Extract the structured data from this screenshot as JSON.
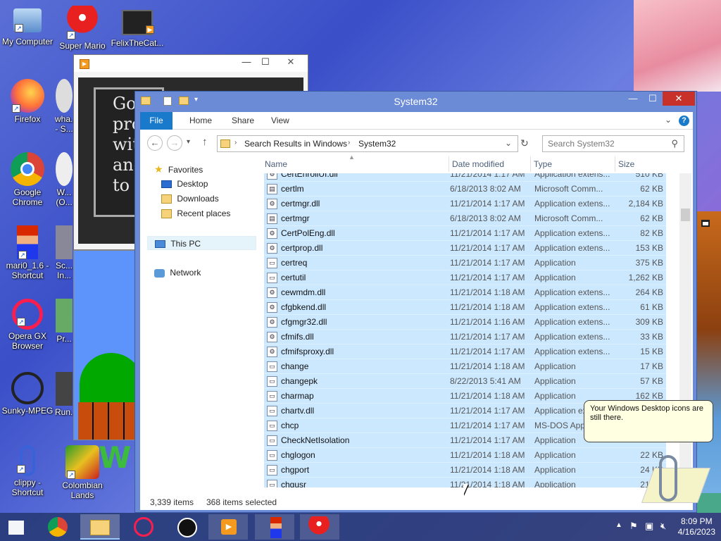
{
  "desktop": {
    "icons": [
      {
        "label": "My Computer"
      },
      {
        "label": "Super Mario"
      },
      {
        "label": "FelixTheCat..."
      },
      {
        "label": "Firefox"
      },
      {
        "label": "wha...\n- S..."
      },
      {
        "label": "Google Chrome"
      },
      {
        "label": "W...\n(O..."
      },
      {
        "label": "mari0_1.6 - Shortcut"
      },
      {
        "label": "Sc...\nIn..."
      },
      {
        "label": "Opera GX Browser"
      },
      {
        "label": "Pr..."
      },
      {
        "label": "Sunky-MPEG"
      },
      {
        "label": "Run..."
      },
      {
        "label": "clippy - Shortcut"
      },
      {
        "label": "Colombian Lands"
      }
    ]
  },
  "media_window": {
    "slide_text": [
      "Go",
      "pro",
      "wit",
      "and",
      "to"
    ],
    "minimize": "—",
    "maximize": "☐",
    "close": "✕"
  },
  "explorer": {
    "title": "System32",
    "minimize": "—",
    "maximize": "☐",
    "close": "✕",
    "ribbon_tabs": [
      "File",
      "Home",
      "Share",
      "View"
    ],
    "address": {
      "crumbs": [
        "Search Results in Windows",
        "System32"
      ]
    },
    "search_placeholder": "Search System32",
    "nav": {
      "favorites": "Favorites",
      "desktop": "Desktop",
      "downloads": "Downloads",
      "recent": "Recent places",
      "thispc": "This PC",
      "network": "Network"
    },
    "columns": {
      "name": "Name",
      "date": "Date modified",
      "type": "Type",
      "size": "Size"
    },
    "files": [
      {
        "name": "CertEnrollUI.dll",
        "date": "11/21/2014 1:17 AM",
        "type": "Application extens...",
        "size": "510 KB"
      },
      {
        "name": "certlm",
        "date": "6/18/2013 8:02 AM",
        "type": "Microsoft Comm...",
        "size": "62 KB"
      },
      {
        "name": "certmgr.dll",
        "date": "11/21/2014 1:17 AM",
        "type": "Application extens...",
        "size": "2,184 KB"
      },
      {
        "name": "certmgr",
        "date": "6/18/2013 8:02 AM",
        "type": "Microsoft Comm...",
        "size": "62 KB"
      },
      {
        "name": "CertPolEng.dll",
        "date": "11/21/2014 1:17 AM",
        "type": "Application extens...",
        "size": "82 KB"
      },
      {
        "name": "certprop.dll",
        "date": "11/21/2014 1:17 AM",
        "type": "Application extens...",
        "size": "153 KB"
      },
      {
        "name": "certreq",
        "date": "11/21/2014 1:17 AM",
        "type": "Application",
        "size": "375 KB"
      },
      {
        "name": "certutil",
        "date": "11/21/2014 1:17 AM",
        "type": "Application",
        "size": "1,262 KB"
      },
      {
        "name": "cewmdm.dll",
        "date": "11/21/2014 1:18 AM",
        "type": "Application extens...",
        "size": "264 KB"
      },
      {
        "name": "cfgbkend.dll",
        "date": "11/21/2014 1:18 AM",
        "type": "Application extens...",
        "size": "61 KB"
      },
      {
        "name": "cfgmgr32.dll",
        "date": "11/21/2014 1:16 AM",
        "type": "Application extens...",
        "size": "309 KB"
      },
      {
        "name": "cfmifs.dll",
        "date": "11/21/2014 1:17 AM",
        "type": "Application extens...",
        "size": "33 KB"
      },
      {
        "name": "cfmifsproxy.dll",
        "date": "11/21/2014 1:17 AM",
        "type": "Application extens...",
        "size": "15 KB"
      },
      {
        "name": "change",
        "date": "11/21/2014 1:18 AM",
        "type": "Application",
        "size": "17 KB"
      },
      {
        "name": "changepk",
        "date": "8/22/2013 5:41 AM",
        "type": "Application",
        "size": "57 KB"
      },
      {
        "name": "charmap",
        "date": "11/21/2014 1:18 AM",
        "type": "Application",
        "size": "162 KB"
      },
      {
        "name": "chartv.dll",
        "date": "11/21/2014 1:17 AM",
        "type": "Application exten...",
        "size": ""
      },
      {
        "name": "chcp",
        "date": "11/21/2014 1:17 AM",
        "type": "MS-DOS App...",
        "size": ""
      },
      {
        "name": "CheckNetIsolation",
        "date": "11/21/2014 1:17 AM",
        "type": "Application",
        "size": ""
      },
      {
        "name": "chglogon",
        "date": "11/21/2014 1:18 AM",
        "type": "Application",
        "size": "22 KB"
      },
      {
        "name": "chgport",
        "date": "11/21/2014 1:18 AM",
        "type": "Application",
        "size": "24 KB"
      },
      {
        "name": "chgusr",
        "date": "11/21/2014 1:18 AM",
        "type": "Application",
        "size": "21 KB"
      }
    ],
    "status": {
      "items": "3,339 items",
      "selected": "368 items selected"
    }
  },
  "balloon": {
    "text": "Your Windows Desktop icons are still there."
  },
  "taskbar": {
    "time": "8:09 PM",
    "date": "4/16/2023"
  },
  "colors": {
    "accent": "#1979ca",
    "selection": "#cce8ff",
    "titlebar": "#6b8bd6",
    "close": "#c7312a"
  }
}
